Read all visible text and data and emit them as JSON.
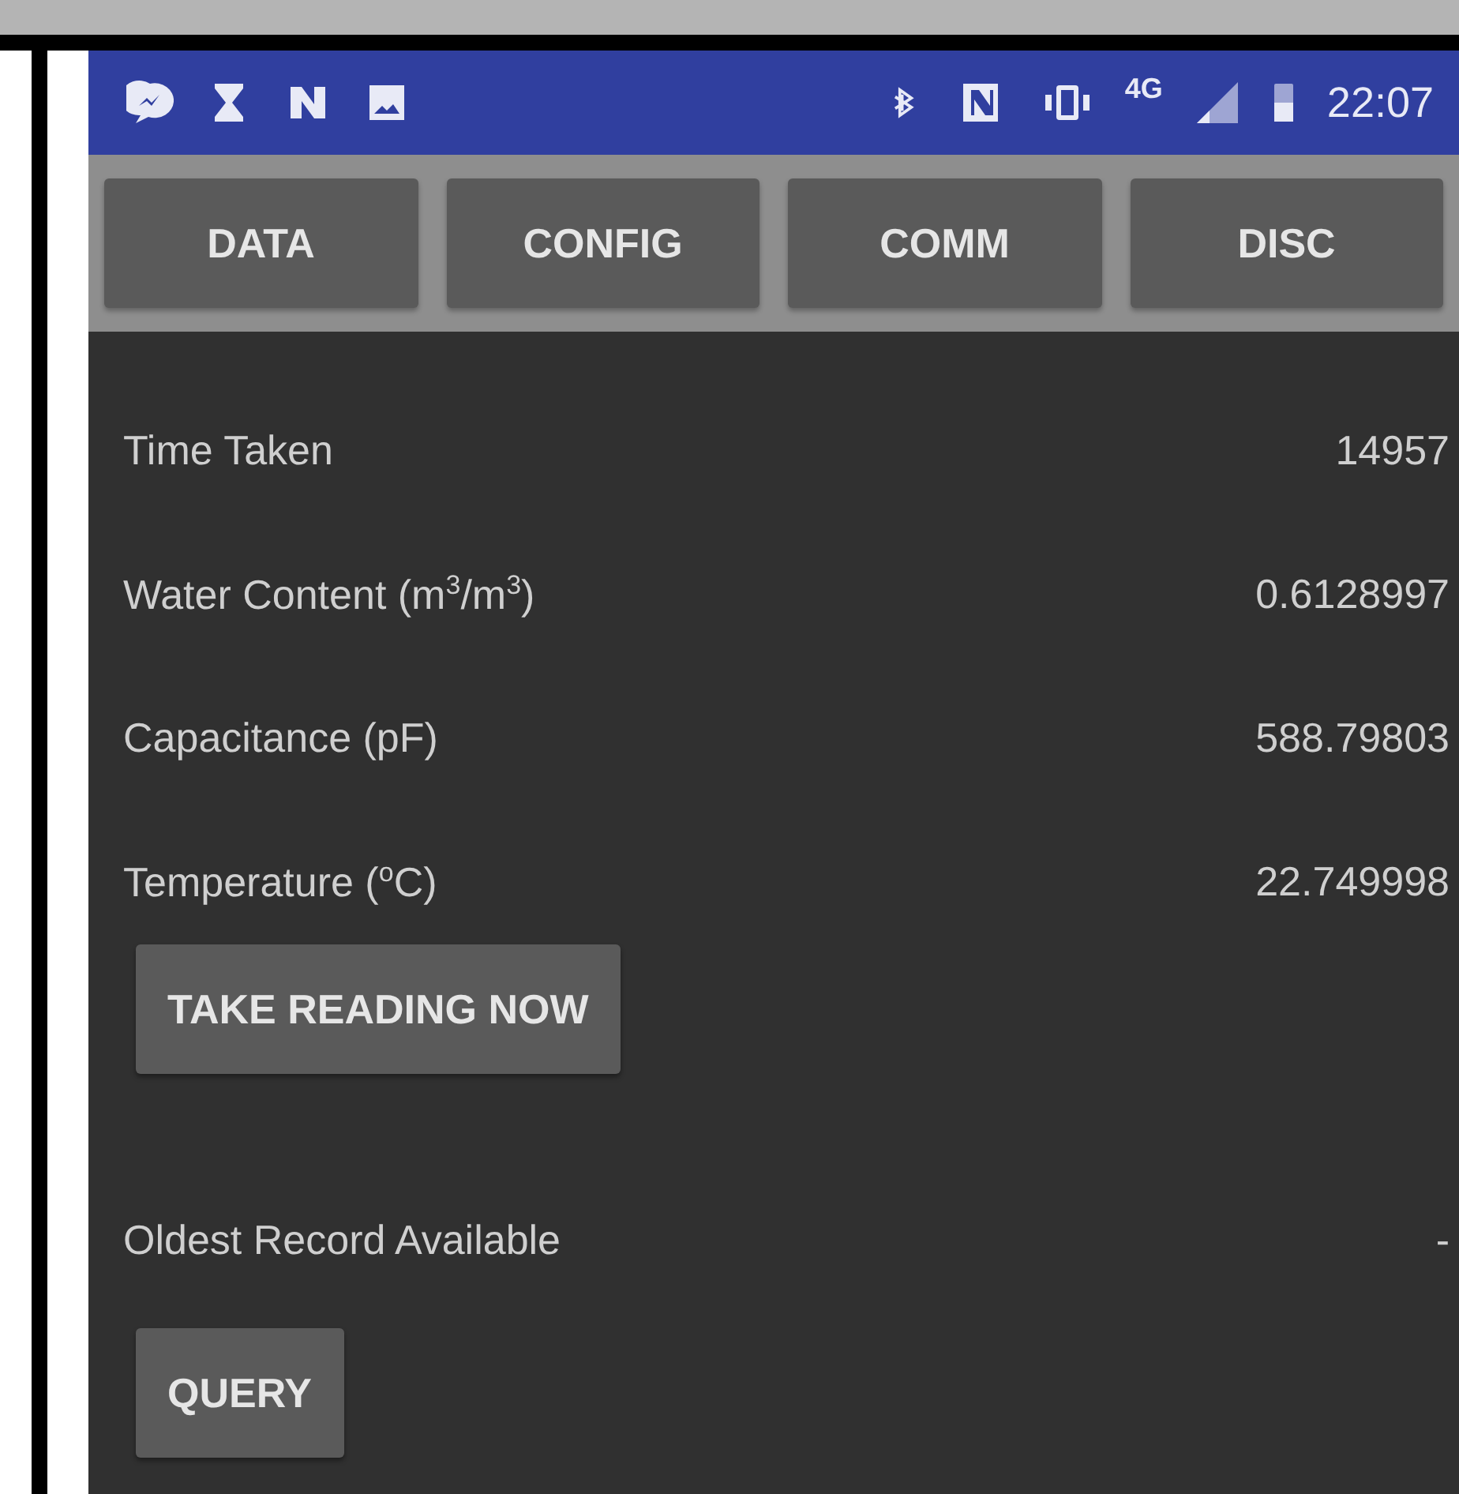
{
  "status_bar": {
    "network": "4G",
    "time": "22:07"
  },
  "tabs": [
    {
      "label": "DATA"
    },
    {
      "label": "CONFIG"
    },
    {
      "label": "COMM"
    },
    {
      "label": "DISC"
    }
  ],
  "readings": [
    {
      "label": "Time Taken",
      "value": "14957"
    },
    {
      "label": "Water Content (m$^{3}$/m$^{3}$)",
      "value": "0.6128997"
    },
    {
      "label": "Capacitance (pF)",
      "value": "588.79803"
    },
    {
      "label": "Temperature ($^{o}$C)",
      "value": "22.749998"
    }
  ],
  "take_reading_button": "TAKE READING NOW",
  "oldest_record": {
    "label": "Oldest Record Available",
    "value": "-"
  },
  "query_button": "QUERY"
}
